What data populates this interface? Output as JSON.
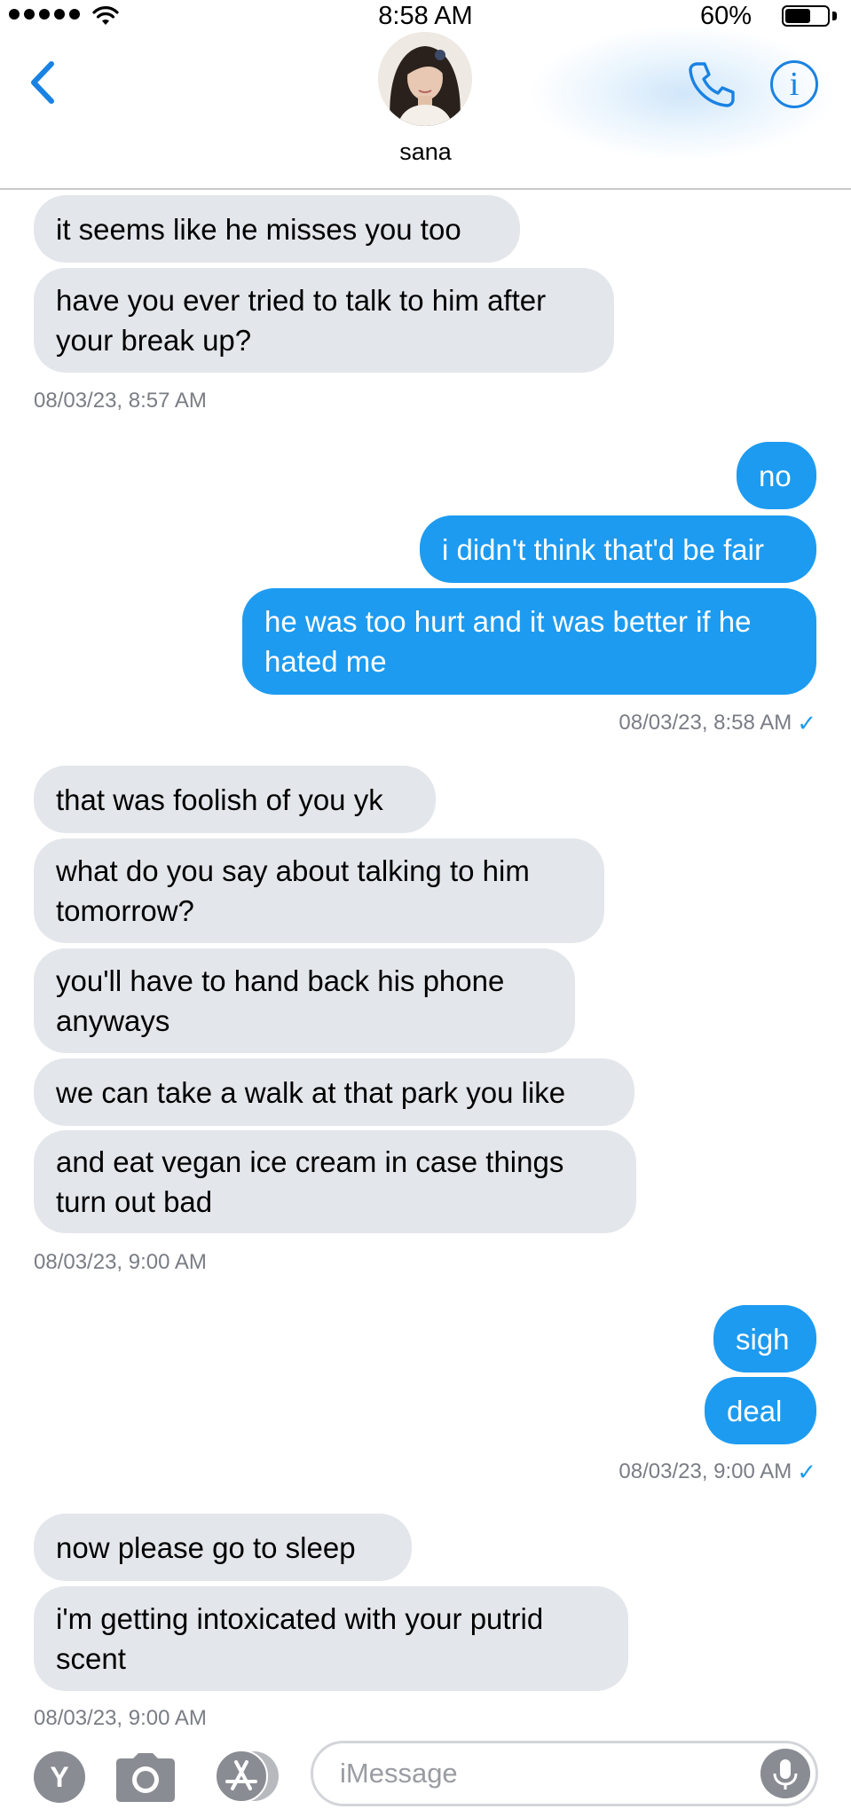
{
  "status_bar": {
    "time": "8:58 AM",
    "battery": "60%",
    "battery_level": 0.6
  },
  "header": {
    "contact_name": "sana"
  },
  "messages": [
    {
      "dir": "in",
      "text": "it seems like he misses you too"
    },
    {
      "dir": "in",
      "text": "have you ever tried to talk to him after your break up?"
    },
    {
      "timestamp": "08/03/23, 8:57 AM"
    },
    {
      "dir": "out",
      "text": "no"
    },
    {
      "dir": "out",
      "text": "i didn't think that'd be fair"
    },
    {
      "dir": "out",
      "text": "he was too hurt and it was better if he hated me"
    },
    {
      "timestamp": "08/03/23, 8:58 AM",
      "read_check": "✓"
    },
    {
      "dir": "in",
      "text": "that was foolish of you yk"
    },
    {
      "dir": "in",
      "text": "what do you say about talking to him tomorrow?"
    },
    {
      "dir": "in",
      "text": "you'll have to hand back his phone anyways"
    },
    {
      "dir": "in",
      "text": "we can take a walk at that park you like"
    },
    {
      "dir": "in",
      "text": "and eat vegan ice cream in case things turn out bad"
    },
    {
      "timestamp": "08/03/23, 9:00 AM"
    },
    {
      "dir": "out",
      "text": "sigh"
    },
    {
      "dir": "out",
      "text": "deal"
    },
    {
      "timestamp": "08/03/23, 9:00 AM",
      "read_check": "✓"
    },
    {
      "dir": "in",
      "text": "now please go to sleep"
    },
    {
      "dir": "in",
      "text": "i'm getting intoxicated with your putrid scent"
    },
    {
      "timestamp": "08/03/23, 9:00 AM"
    }
  ],
  "compose": {
    "app_label": "Y",
    "placeholder": "iMessage"
  },
  "colors": {
    "outgoing": "#1d9bf0",
    "incoming": "#e3e6ea",
    "accent": "#1a82e2",
    "timestamp": "#7a7d85"
  },
  "icons": [
    "back-chevron-icon",
    "phone-icon",
    "info-icon",
    "camera-icon",
    "app-store-icon",
    "microphone-icon"
  ]
}
